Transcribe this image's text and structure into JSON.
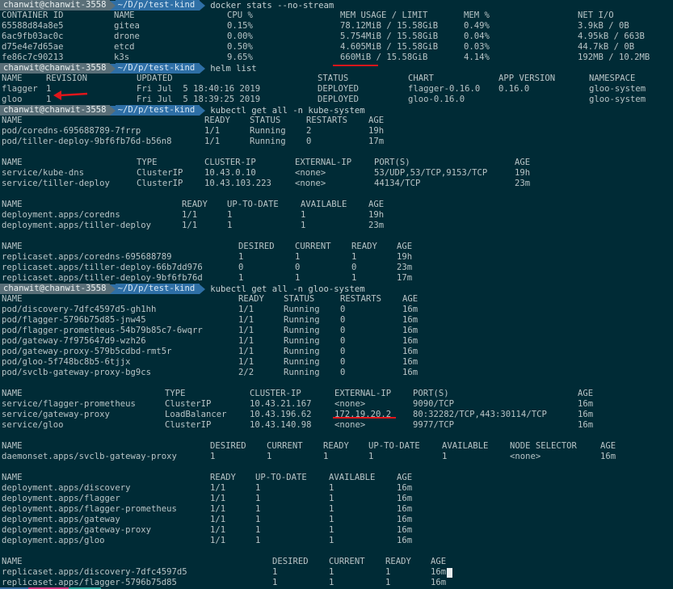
{
  "colors": {
    "background": "#002b36",
    "annotation": "#e0161b",
    "prompt_user_bg": "#5a6f78",
    "prompt_path_bg": "#2e6fa6"
  },
  "prompt": {
    "user": "chanwit@chanwit-3558",
    "path": "~/D/p/test-kind"
  },
  "commands": [
    "docker stats --no-stream",
    "helm list",
    "kubectl get all -n kube-system",
    "kubectl get all -n gloo-system"
  ],
  "docker_stats": {
    "headers": [
      "CONTAINER ID",
      "NAME",
      "CPU %",
      "MEM USAGE / LIMIT",
      "MEM %",
      "NET I/O"
    ],
    "rows": [
      [
        "65588d84a8e5",
        "gitea",
        "0.15%",
        "78.12MiB / 15.58GiB",
        "0.49%",
        "3.9kB / 0B"
      ],
      [
        "6ac9fb03ac0c",
        "drone",
        "0.00%",
        "5.754MiB / 15.58GiB",
        "0.04%",
        "4.95kB / 663B"
      ],
      [
        "d75e4e7d65ae",
        "etcd",
        "0.50%",
        "4.605MiB / 15.58GiB",
        "0.03%",
        "44.7kB / 0B"
      ],
      [
        "fe86c7c90213",
        "k3s",
        "9.65%",
        "660MiB / 15.58GiB",
        "4.14%",
        "192MB / 10.2MB"
      ]
    ]
  },
  "helm": {
    "headers": [
      "NAME",
      "REVISION",
      "UPDATED",
      "STATUS",
      "CHART",
      "APP VERSION",
      "NAMESPACE"
    ],
    "rows": [
      [
        "flagger",
        "1",
        "Fri Jul  5 18:40:16 2019",
        "DEPLOYED",
        "flagger-0.16.0",
        "0.16.0",
        "gloo-system"
      ],
      [
        "gloo",
        "1",
        "Fri Jul  5 18:39:25 2019",
        "DEPLOYED",
        "gloo-0.16.0",
        "",
        "gloo-system"
      ]
    ]
  },
  "kube_system": {
    "pods": {
      "headers": [
        "NAME",
        "READY",
        "STATUS",
        "RESTARTS",
        "AGE"
      ],
      "rows": [
        [
          "pod/coredns-695688789-7frrp",
          "1/1",
          "Running",
          "2",
          "19h"
        ],
        [
          "pod/tiller-deploy-9bf6fb76d-b56n8",
          "1/1",
          "Running",
          "0",
          "17m"
        ]
      ]
    },
    "services": {
      "headers": [
        "NAME",
        "TYPE",
        "CLUSTER-IP",
        "EXTERNAL-IP",
        "PORT(S)",
        "AGE"
      ],
      "rows": [
        [
          "service/kube-dns",
          "ClusterIP",
          "10.43.0.10",
          "<none>",
          "53/UDP,53/TCP,9153/TCP",
          "19h"
        ],
        [
          "service/tiller-deploy",
          "ClusterIP",
          "10.43.103.223",
          "<none>",
          "44134/TCP",
          "23m"
        ]
      ]
    },
    "deployments": {
      "headers": [
        "NAME",
        "READY",
        "UP-TO-DATE",
        "AVAILABLE",
        "AGE"
      ],
      "rows": [
        [
          "deployment.apps/coredns",
          "1/1",
          "1",
          "1",
          "19h"
        ],
        [
          "deployment.apps/tiller-deploy",
          "1/1",
          "1",
          "1",
          "23m"
        ]
      ]
    },
    "replicasets": {
      "headers": [
        "NAME",
        "DESIRED",
        "CURRENT",
        "READY",
        "AGE"
      ],
      "rows": [
        [
          "replicaset.apps/coredns-695688789",
          "1",
          "1",
          "1",
          "19h"
        ],
        [
          "replicaset.apps/tiller-deploy-66b7dd976",
          "0",
          "0",
          "0",
          "23m"
        ],
        [
          "replicaset.apps/tiller-deploy-9bf6fb76d",
          "1",
          "1",
          "1",
          "17m"
        ]
      ]
    }
  },
  "gloo_system": {
    "pods": {
      "headers": [
        "NAME",
        "READY",
        "STATUS",
        "RESTARTS",
        "AGE"
      ],
      "rows": [
        [
          "pod/discovery-7dfc4597d5-gh1hh",
          "1/1",
          "Running",
          "0",
          "16m"
        ],
        [
          "pod/flagger-5796b75d85-jnw45",
          "1/1",
          "Running",
          "0",
          "16m"
        ],
        [
          "pod/flagger-prometheus-54b79b85c7-6wqrr",
          "1/1",
          "Running",
          "0",
          "16m"
        ],
        [
          "pod/gateway-7f975647d9-wzh26",
          "1/1",
          "Running",
          "0",
          "16m"
        ],
        [
          "pod/gateway-proxy-579b5cdbd-rmt5r",
          "1/1",
          "Running",
          "0",
          "16m"
        ],
        [
          "pod/gloo-5f748bc8b5-6tjjx",
          "1/1",
          "Running",
          "0",
          "16m"
        ],
        [
          "pod/svclb-gateway-proxy-bg9cs",
          "2/2",
          "Running",
          "0",
          "16m"
        ]
      ]
    },
    "services": {
      "headers": [
        "NAME",
        "TYPE",
        "CLUSTER-IP",
        "EXTERNAL-IP",
        "PORT(S)",
        "AGE"
      ],
      "rows": [
        [
          "service/flagger-prometheus",
          "ClusterIP",
          "10.43.21.167",
          "<none>",
          "9090/TCP",
          "16m"
        ],
        [
          "service/gateway-proxy",
          "LoadBalancer",
          "10.43.196.62",
          "172.19.20.2",
          "80:32282/TCP,443:30114/TCP",
          "16m"
        ],
        [
          "service/gloo",
          "ClusterIP",
          "10.43.140.98",
          "<none>",
          "9977/TCP",
          "16m"
        ]
      ]
    },
    "daemonsets": {
      "headers": [
        "NAME",
        "DESIRED",
        "CURRENT",
        "READY",
        "UP-TO-DATE",
        "AVAILABLE",
        "NODE SELECTOR",
        "AGE"
      ],
      "rows": [
        [
          "daemonset.apps/svclb-gateway-proxy",
          "1",
          "1",
          "1",
          "1",
          "1",
          "<none>",
          "16m"
        ]
      ]
    },
    "deployments": {
      "headers": [
        "NAME",
        "READY",
        "UP-TO-DATE",
        "AVAILABLE",
        "AGE"
      ],
      "rows": [
        [
          "deployment.apps/discovery",
          "1/1",
          "1",
          "1",
          "16m"
        ],
        [
          "deployment.apps/flagger",
          "1/1",
          "1",
          "1",
          "16m"
        ],
        [
          "deployment.apps/flagger-prometheus",
          "1/1",
          "1",
          "1",
          "16m"
        ],
        [
          "deployment.apps/gateway",
          "1/1",
          "1",
          "1",
          "16m"
        ],
        [
          "deployment.apps/gateway-proxy",
          "1/1",
          "1",
          "1",
          "16m"
        ],
        [
          "deployment.apps/gloo",
          "1/1",
          "1",
          "1",
          "16m"
        ]
      ]
    },
    "replicasets": {
      "headers": [
        "NAME",
        "DESIRED",
        "CURRENT",
        "READY",
        "AGE"
      ],
      "rows": [
        [
          "replicaset.apps/discovery-7dfc4597d5",
          "1",
          "1",
          "1",
          "16m"
        ],
        [
          "replicaset.apps/flagger-5796b75d85",
          "1",
          "1",
          "1",
          "16m"
        ]
      ]
    }
  }
}
